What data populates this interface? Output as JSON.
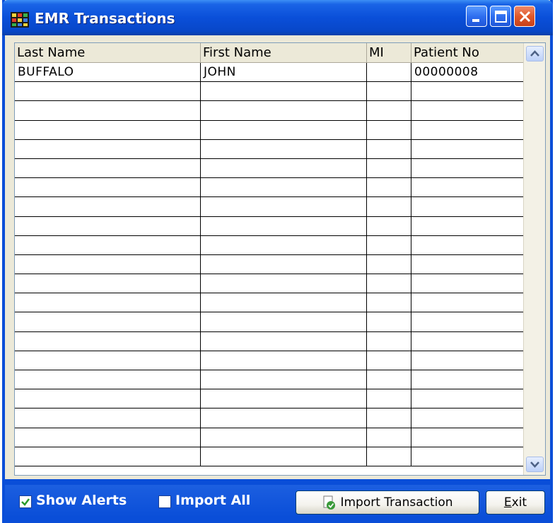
{
  "window": {
    "title": "EMR Transactions",
    "icon": "app-grid-icon",
    "controls": [
      "minimize-icon",
      "maximize-icon",
      "close-icon"
    ]
  },
  "grid": {
    "columns": [
      "Last Name",
      "First Name",
      "MI",
      "Patient No"
    ],
    "rows": [
      [
        "BUFFALO",
        "JOHN",
        "",
        "00000008"
      ],
      [
        "",
        "",
        "",
        ""
      ],
      [
        "",
        "",
        "",
        ""
      ],
      [
        "",
        "",
        "",
        ""
      ],
      [
        "",
        "",
        "",
        ""
      ],
      [
        "",
        "",
        "",
        ""
      ],
      [
        "",
        "",
        "",
        ""
      ],
      [
        "",
        "",
        "",
        ""
      ],
      [
        "",
        "",
        "",
        ""
      ],
      [
        "",
        "",
        "",
        ""
      ],
      [
        "",
        "",
        "",
        ""
      ],
      [
        "",
        "",
        "",
        ""
      ],
      [
        "",
        "",
        "",
        ""
      ],
      [
        "",
        "",
        "",
        ""
      ],
      [
        "",
        "",
        "",
        ""
      ],
      [
        "",
        "",
        "",
        ""
      ],
      [
        "",
        "",
        "",
        ""
      ],
      [
        "",
        "",
        "",
        ""
      ],
      [
        "",
        "",
        "",
        ""
      ],
      [
        "",
        "",
        "",
        ""
      ],
      [
        "",
        "",
        "",
        ""
      ]
    ]
  },
  "footer": {
    "show_alerts": {
      "label": "Show Alerts",
      "checked": true
    },
    "import_all": {
      "label": "Import All",
      "checked": false
    },
    "import_button": "Import Transaction",
    "exit_button": "Exit"
  },
  "colors": {
    "titlebar": "#0a4fd9",
    "window_bg": "#ece9d8",
    "grid_line": "#000000"
  }
}
